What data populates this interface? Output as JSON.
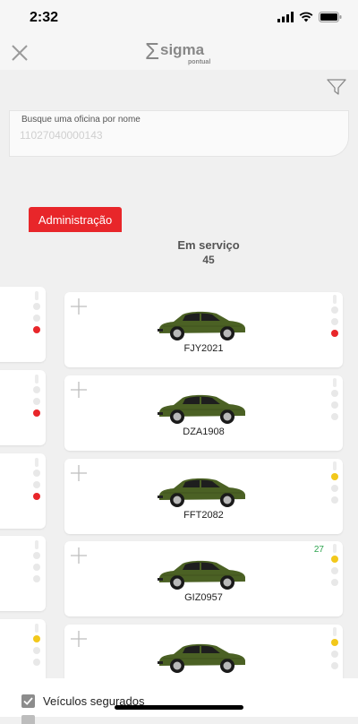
{
  "status": {
    "time": "2:32"
  },
  "header": {
    "logo_text": "sigma",
    "logo_subtext": "pontual",
    "logo_symbol": "Σ"
  },
  "search": {
    "label": "Busque uma oficina por nome",
    "value": "",
    "placeholder": "11027040000143"
  },
  "tab": {
    "label": "Administração"
  },
  "column": {
    "title": "Em serviço",
    "count": "45"
  },
  "cards": [
    {
      "plate": "FJY2021",
      "light": "red",
      "counter": ""
    },
    {
      "plate": "DZA1908",
      "light": "none",
      "counter": ""
    },
    {
      "plate": "FFT2082",
      "light": "yellow",
      "counter": ""
    },
    {
      "plate": "GIZ0957",
      "light": "yellow",
      "counter": "27"
    },
    {
      "plate": "",
      "light": "yellow",
      "counter": ""
    }
  ],
  "left_cards": [
    {
      "light": "red"
    },
    {
      "light": "red"
    },
    {
      "light": "red"
    },
    {
      "light": "none"
    },
    {
      "light": "yellow"
    }
  ],
  "colors": {
    "red": "#e8262a",
    "yellow": "#f2c81b",
    "green_counter": "#2ea44f",
    "car": "#4b6124"
  },
  "bottom": {
    "checkbox_label": "Veículos segurados",
    "checked": true
  },
  "icons": {
    "close": "close-icon",
    "filter": "filter-icon",
    "plus": "plus-icon",
    "car": "car-icon"
  }
}
